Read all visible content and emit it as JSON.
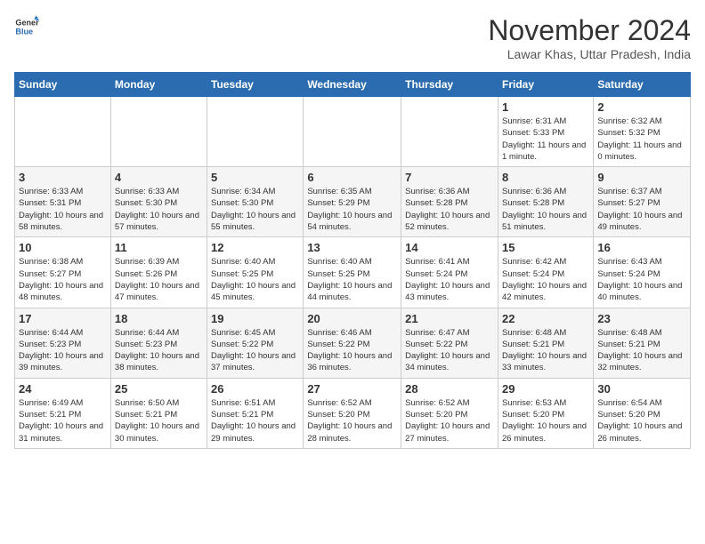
{
  "header": {
    "logo_line1": "General",
    "logo_line2": "Blue",
    "month": "November 2024",
    "location": "Lawar Khas, Uttar Pradesh, India"
  },
  "weekdays": [
    "Sunday",
    "Monday",
    "Tuesday",
    "Wednesday",
    "Thursday",
    "Friday",
    "Saturday"
  ],
  "weeks": [
    [
      {
        "day": "",
        "info": ""
      },
      {
        "day": "",
        "info": ""
      },
      {
        "day": "",
        "info": ""
      },
      {
        "day": "",
        "info": ""
      },
      {
        "day": "",
        "info": ""
      },
      {
        "day": "1",
        "info": "Sunrise: 6:31 AM\nSunset: 5:33 PM\nDaylight: 11 hours and 1 minute."
      },
      {
        "day": "2",
        "info": "Sunrise: 6:32 AM\nSunset: 5:32 PM\nDaylight: 11 hours and 0 minutes."
      }
    ],
    [
      {
        "day": "3",
        "info": "Sunrise: 6:33 AM\nSunset: 5:31 PM\nDaylight: 10 hours and 58 minutes."
      },
      {
        "day": "4",
        "info": "Sunrise: 6:33 AM\nSunset: 5:30 PM\nDaylight: 10 hours and 57 minutes."
      },
      {
        "day": "5",
        "info": "Sunrise: 6:34 AM\nSunset: 5:30 PM\nDaylight: 10 hours and 55 minutes."
      },
      {
        "day": "6",
        "info": "Sunrise: 6:35 AM\nSunset: 5:29 PM\nDaylight: 10 hours and 54 minutes."
      },
      {
        "day": "7",
        "info": "Sunrise: 6:36 AM\nSunset: 5:28 PM\nDaylight: 10 hours and 52 minutes."
      },
      {
        "day": "8",
        "info": "Sunrise: 6:36 AM\nSunset: 5:28 PM\nDaylight: 10 hours and 51 minutes."
      },
      {
        "day": "9",
        "info": "Sunrise: 6:37 AM\nSunset: 5:27 PM\nDaylight: 10 hours and 49 minutes."
      }
    ],
    [
      {
        "day": "10",
        "info": "Sunrise: 6:38 AM\nSunset: 5:27 PM\nDaylight: 10 hours and 48 minutes."
      },
      {
        "day": "11",
        "info": "Sunrise: 6:39 AM\nSunset: 5:26 PM\nDaylight: 10 hours and 47 minutes."
      },
      {
        "day": "12",
        "info": "Sunrise: 6:40 AM\nSunset: 5:25 PM\nDaylight: 10 hours and 45 minutes."
      },
      {
        "day": "13",
        "info": "Sunrise: 6:40 AM\nSunset: 5:25 PM\nDaylight: 10 hours and 44 minutes."
      },
      {
        "day": "14",
        "info": "Sunrise: 6:41 AM\nSunset: 5:24 PM\nDaylight: 10 hours and 43 minutes."
      },
      {
        "day": "15",
        "info": "Sunrise: 6:42 AM\nSunset: 5:24 PM\nDaylight: 10 hours and 42 minutes."
      },
      {
        "day": "16",
        "info": "Sunrise: 6:43 AM\nSunset: 5:24 PM\nDaylight: 10 hours and 40 minutes."
      }
    ],
    [
      {
        "day": "17",
        "info": "Sunrise: 6:44 AM\nSunset: 5:23 PM\nDaylight: 10 hours and 39 minutes."
      },
      {
        "day": "18",
        "info": "Sunrise: 6:44 AM\nSunset: 5:23 PM\nDaylight: 10 hours and 38 minutes."
      },
      {
        "day": "19",
        "info": "Sunrise: 6:45 AM\nSunset: 5:22 PM\nDaylight: 10 hours and 37 minutes."
      },
      {
        "day": "20",
        "info": "Sunrise: 6:46 AM\nSunset: 5:22 PM\nDaylight: 10 hours and 36 minutes."
      },
      {
        "day": "21",
        "info": "Sunrise: 6:47 AM\nSunset: 5:22 PM\nDaylight: 10 hours and 34 minutes."
      },
      {
        "day": "22",
        "info": "Sunrise: 6:48 AM\nSunset: 5:21 PM\nDaylight: 10 hours and 33 minutes."
      },
      {
        "day": "23",
        "info": "Sunrise: 6:48 AM\nSunset: 5:21 PM\nDaylight: 10 hours and 32 minutes."
      }
    ],
    [
      {
        "day": "24",
        "info": "Sunrise: 6:49 AM\nSunset: 5:21 PM\nDaylight: 10 hours and 31 minutes."
      },
      {
        "day": "25",
        "info": "Sunrise: 6:50 AM\nSunset: 5:21 PM\nDaylight: 10 hours and 30 minutes."
      },
      {
        "day": "26",
        "info": "Sunrise: 6:51 AM\nSunset: 5:21 PM\nDaylight: 10 hours and 29 minutes."
      },
      {
        "day": "27",
        "info": "Sunrise: 6:52 AM\nSunset: 5:20 PM\nDaylight: 10 hours and 28 minutes."
      },
      {
        "day": "28",
        "info": "Sunrise: 6:52 AM\nSunset: 5:20 PM\nDaylight: 10 hours and 27 minutes."
      },
      {
        "day": "29",
        "info": "Sunrise: 6:53 AM\nSunset: 5:20 PM\nDaylight: 10 hours and 26 minutes."
      },
      {
        "day": "30",
        "info": "Sunrise: 6:54 AM\nSunset: 5:20 PM\nDaylight: 10 hours and 26 minutes."
      }
    ]
  ]
}
